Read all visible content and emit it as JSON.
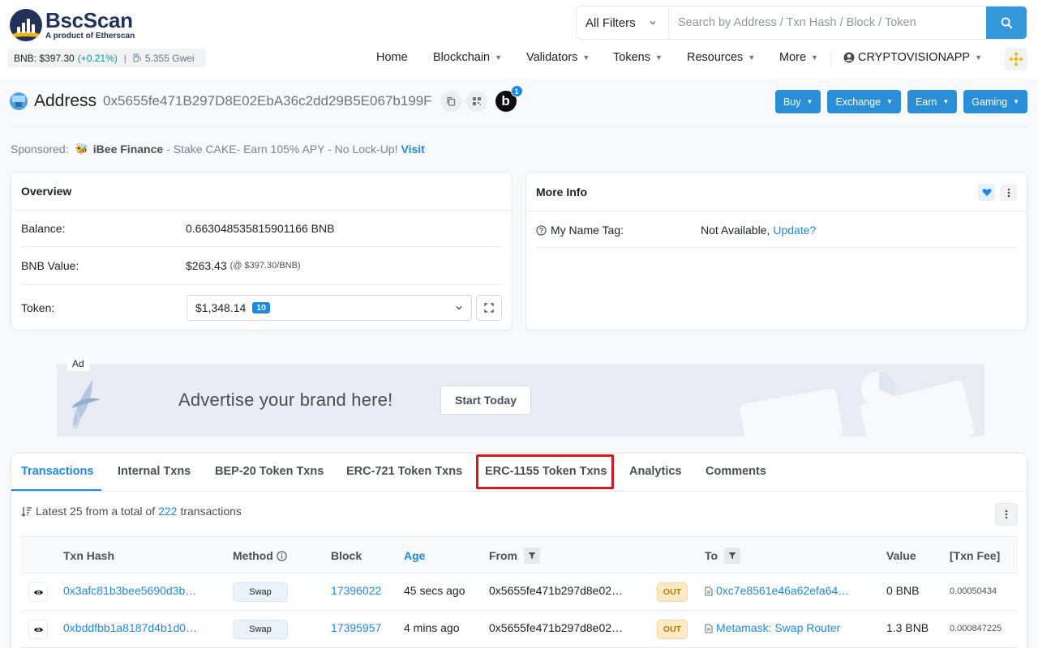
{
  "brand": {
    "name": "BscScan",
    "tagline": "A product of Etherscan"
  },
  "price_bar": {
    "price": "BNB: $397.30",
    "change": "(+0.21%)",
    "separator": "|",
    "gas": "5.355 Gwei"
  },
  "search": {
    "filter_label": "All Filters",
    "placeholder": "Search by Address / Txn Hash / Block / Token"
  },
  "nav": {
    "items": [
      {
        "label": "Home"
      },
      {
        "label": "Blockchain"
      },
      {
        "label": "Validators"
      },
      {
        "label": "Tokens"
      },
      {
        "label": "Resources"
      },
      {
        "label": "More"
      }
    ],
    "account": "CRYPTOVISIONAPP"
  },
  "page": {
    "title": "Address",
    "address": "0x5655fe471B297D8E02EbA36c2dd29B5E067b199F",
    "badge_letter": "b",
    "badge_count": "1",
    "actions": [
      "Buy",
      "Exchange",
      "Earn",
      "Gaming"
    ]
  },
  "sponsored": {
    "label": "Sponsored:",
    "name": "iBee Finance",
    "message": "- Stake CAKE- Earn 105% APY - No Lock-Up!",
    "cta": "Visit"
  },
  "overview": {
    "title": "Overview",
    "balance_label": "Balance:",
    "balance_value": "0.663048535815901166 BNB",
    "value_label": "BNB Value:",
    "value_amount": "$263.43",
    "value_rate": "(@ $397.30/BNB)",
    "token_label": "Token:",
    "token_total": "$1,348.14",
    "token_count": "10"
  },
  "more_info": {
    "title": "More Info",
    "name_tag_label": "My Name Tag:",
    "name_tag_value": "Not Available,",
    "name_tag_link": "Update?"
  },
  "ad": {
    "label": "Ad",
    "headline": "Advertise your brand here!",
    "cta": "Start Today"
  },
  "tabs": [
    {
      "label": "Transactions",
      "active": true
    },
    {
      "label": "Internal Txns"
    },
    {
      "label": "BEP-20 Token Txns"
    },
    {
      "label": "ERC-721 Token Txns"
    },
    {
      "label": "ERC-1155 Token Txns",
      "highlighted": true
    },
    {
      "label": "Analytics"
    },
    {
      "label": "Comments"
    }
  ],
  "summary": {
    "prefix": "Latest 25 from a total of",
    "count": "222",
    "suffix": "transactions"
  },
  "table": {
    "columns": [
      "Txn Hash",
      "Method",
      "Block",
      "Age",
      "From",
      "To",
      "Value",
      "[Txn Fee]"
    ],
    "rows": [
      {
        "hash": "0x3afc81b3bee5690d3b…",
        "method": "Swap",
        "block": "17396022",
        "age": "45 secs ago",
        "from": "0x5655fe471b297d8e02…",
        "direction": "OUT",
        "to": "0xc7e8561e46a62efa64…",
        "value": "0 BNB",
        "fee": "0.00050434"
      },
      {
        "hash": "0xbddfbb1a8187d4b1d0…",
        "method": "Swap",
        "block": "17395957",
        "age": "4 mins ago",
        "from": "0x5655fe471b297d8e02…",
        "direction": "OUT",
        "to": "Metamask: Swap Router",
        "value": "1.3 BNB",
        "fee": "0.000847225"
      }
    ]
  },
  "colors": {
    "accent": "#1e88e5",
    "brand_navy": "#21325b",
    "brand_yellow": "#f0b90b",
    "highlight": "#d7181f",
    "positive": "#00a186"
  }
}
